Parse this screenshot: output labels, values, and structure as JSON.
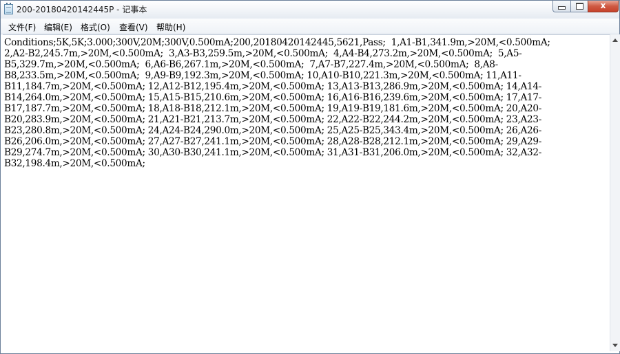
{
  "window": {
    "title": "200-20180420142445P - 记事本",
    "controls": {
      "minimize": "",
      "maximize": "",
      "close": "x"
    }
  },
  "menu": {
    "items": [
      {
        "label": "文件(F)"
      },
      {
        "label": "编辑(E)"
      },
      {
        "label": "格式(O)"
      },
      {
        "label": "查看(V)"
      },
      {
        "label": "帮助(H)"
      }
    ]
  },
  "document": {
    "lines": [
      "Conditions;5K,5K;3.000;300V,20M;300V,0.500mA;200,20180420142445,5621,Pass;  1,A1-B1,341.9m,>20M,<0.500mA;",
      "2,A2-B2,245.7m,>20M,<0.500mA;  3,A3-B3,259.5m,>20M,<0.500mA;  4,A4-B4,273.2m,>20M,<0.500mA;  5,A5-",
      "B5,329.7m,>20M,<0.500mA;  6,A6-B6,267.1m,>20M,<0.500mA;  7,A7-B7,227.4m,>20M,<0.500mA;  8,A8-",
      "B8,233.5m,>20M,<0.500mA;  9,A9-B9,192.3m,>20M,<0.500mA; 10,A10-B10,221.3m,>20M,<0.500mA; 11,A11-",
      "B11,184.7m,>20M,<0.500mA; 12,A12-B12,195.4m,>20M,<0.500mA; 13,A13-B13,286.9m,>20M,<0.500mA; 14,A14-",
      "B14,264.0m,>20M,<0.500mA; 15,A15-B15,210.6m,>20M,<0.500mA; 16,A16-B16,239.6m,>20M,<0.500mA; 17,A17-",
      "B17,187.7m,>20M,<0.500mA; 18,A18-B18,212.1m,>20M,<0.500mA; 19,A19-B19,181.6m,>20M,<0.500mA; 20,A20-",
      "B20,283.9m,>20M,<0.500mA; 21,A21-B21,213.7m,>20M,<0.500mA; 22,A22-B22,244.2m,>20M,<0.500mA; 23,A23-",
      "B23,280.8m,>20M,<0.500mA; 24,A24-B24,290.0m,>20M,<0.500mA; 25,A25-B25,343.4m,>20M,<0.500mA; 26,A26-",
      "B26,206.0m,>20M,<0.500mA; 27,A27-B27,241.1m,>20M,<0.500mA; 28,A28-B28,212.1m,>20M,<0.500mA; 29,A29-",
      "B29,274.7m,>20M,<0.500mA; 30,A30-B30,241.1m,>20M,<0.500mA; 31,A31-B31,206.0m,>20M,<0.500mA; 32,A32-",
      "B32,198.4m,>20M,<0.500mA;"
    ]
  }
}
